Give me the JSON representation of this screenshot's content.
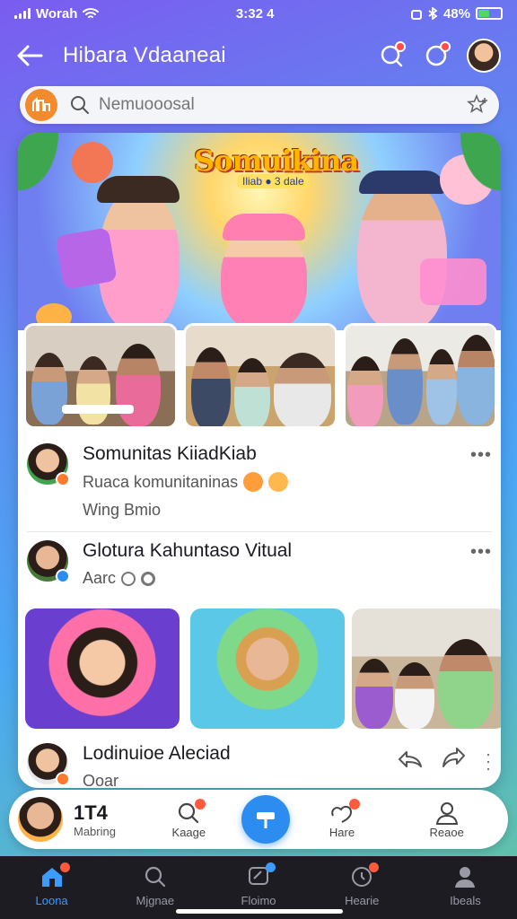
{
  "status_bar": {
    "carrier": "Worah",
    "time": "3:32 4",
    "battery": "48%"
  },
  "header": {
    "title": "Hibara Vdaaneai"
  },
  "search": {
    "placeholder": "Nemuooosal"
  },
  "hero": {
    "brand": "Somuikina",
    "sub_label": "Iliab ● 3 dale"
  },
  "posts": [
    {
      "name": "Somunitas KiiadKiab",
      "meta": "Ruaca komunitaninas",
      "sub": "Wing Bmio"
    },
    {
      "name": "Glotura Kahuntaso Vitual",
      "meta": "Aarc"
    },
    {
      "name": "Lodinuioe Aleciad",
      "meta": "Ooar"
    }
  ],
  "bottom_card": {
    "counter": "1T4",
    "counter_label": "Mabring",
    "items": [
      {
        "label": "Kaage",
        "icon": "search-icon"
      },
      {
        "label": "Hare",
        "icon": "heart-icon"
      },
      {
        "label": "Reaoe",
        "icon": "person-icon"
      }
    ]
  },
  "tabs": [
    {
      "label": "Loona",
      "icon": "home-icon",
      "active": true
    },
    {
      "label": "Mjgnae",
      "icon": "search-icon"
    },
    {
      "label": "Floimo",
      "icon": "chat-icon"
    },
    {
      "label": "Hearie",
      "icon": "bell-icon"
    },
    {
      "label": "Ibeals",
      "icon": "profile-icon"
    }
  ],
  "colors": {
    "accent": "#2d8cf0",
    "notification": "#ff4d4d",
    "tab_bar": "#1c1c22"
  }
}
